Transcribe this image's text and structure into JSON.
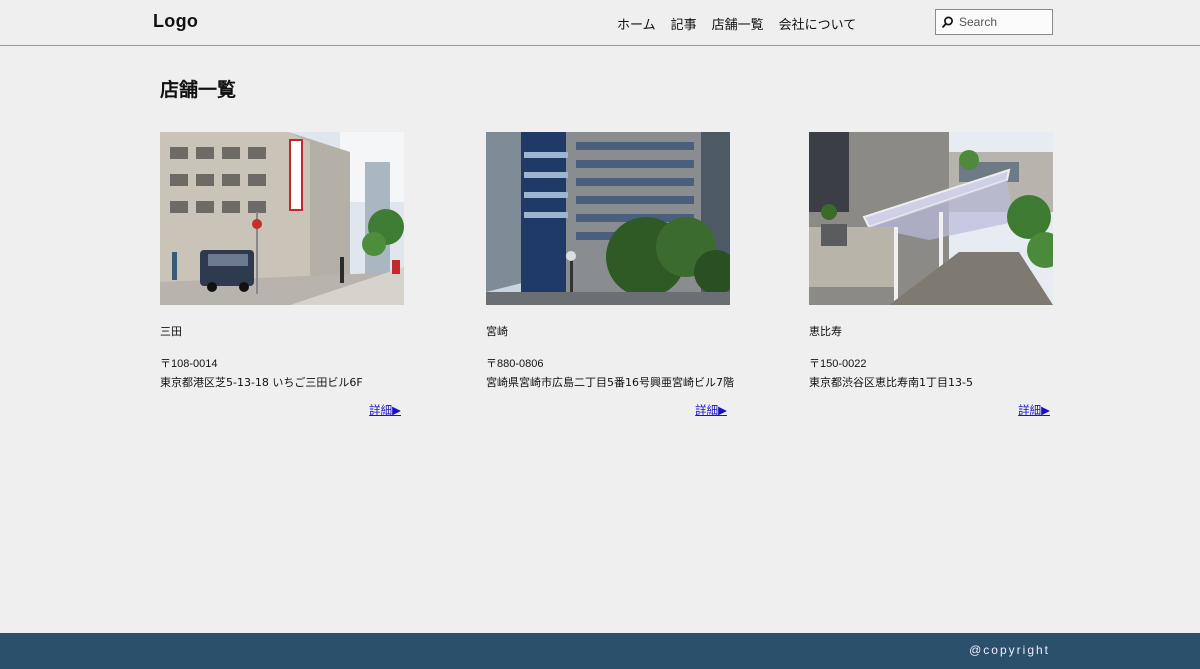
{
  "header": {
    "logo": "Logo",
    "nav": [
      "ホーム",
      "記事",
      "店舗一覧",
      "会社について"
    ],
    "search_placeholder": "Search"
  },
  "page_title": "店舗一覧",
  "stores": [
    {
      "name": "三田",
      "zip": "〒108-0014",
      "address": "東京都港区芝5-13-18 いちご三田ビル6F",
      "link": "詳細▶"
    },
    {
      "name": "宮崎",
      "zip": "〒880-0806",
      "address": "宮崎県宮崎市広島二丁目5番16号興亜宮崎ビル7階",
      "link": "詳細▶"
    },
    {
      "name": "恵比寿",
      "zip": "〒150-0022",
      "address": "東京都渋谷区恵比寿南1丁目13-5",
      "link": "詳細▶"
    }
  ],
  "footer": {
    "copyright": "@copyright"
  },
  "colors": {
    "background": "#efefef",
    "footer": "#2a506b",
    "link": "#1a10c8"
  },
  "icons": [
    "search-icon"
  ]
}
